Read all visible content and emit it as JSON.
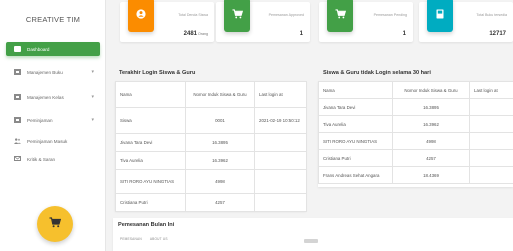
{
  "brand": "CREATIVE TIM",
  "sidebar": {
    "items": [
      {
        "label": "Dashboard",
        "icon": "dashboard-icon",
        "active": true,
        "chevron": ""
      },
      {
        "label": "Manajemen Buku",
        "icon": "book-icon",
        "active": false,
        "chevron": "▾"
      },
      {
        "label": "Manajemen Kelas",
        "icon": "class-icon",
        "active": false,
        "chevron": "▾"
      },
      {
        "label": "Peminjaman",
        "icon": "loan-icon",
        "active": false,
        "chevron": "▾"
      },
      {
        "label": "Peminjaman Masuk",
        "icon": "users-icon",
        "active": false,
        "chevron": ""
      },
      {
        "label": "Kritik & Saran",
        "icon": "message-icon",
        "active": false,
        "chevron": ""
      }
    ]
  },
  "cards": [
    {
      "title": "Total Denda Siswa",
      "value": "2481",
      "unit": "Orang",
      "color": "#fb8c00",
      "icon": "user-icon"
    },
    {
      "title": "Pemesanan Approved",
      "value": "1",
      "unit": "",
      "color": "#43a047",
      "icon": "cart-icon"
    },
    {
      "title": "Pemesanan Pending",
      "value": "1",
      "unit": "",
      "color": "#43a047",
      "icon": "cart-icon"
    },
    {
      "title": "Total Buku tersedia",
      "value": "12717",
      "unit": "",
      "color": "#00acc1",
      "icon": "book-icon"
    }
  ],
  "login_table": {
    "title": "Terakhir Login Siswa & Guru",
    "headers": [
      "Nama",
      "Nomor Induk Siswa & Guru",
      "Last login at"
    ],
    "rows": [
      [
        "Siswa",
        "0001",
        "2021-02-19 10:50:12"
      ],
      [
        "Jivana Tara Devi",
        "16.3895",
        ""
      ],
      [
        "Tiva Aurelia",
        "16.3962",
        ""
      ],
      [
        "SITI RORO AYU NINGTIAS",
        "4998",
        ""
      ],
      [
        "Cristiana Putri",
        "4257",
        ""
      ]
    ]
  },
  "no_login_table": {
    "title": "Siswa & Guru tidak Login selama 30 hari",
    "headers": [
      "Nama",
      "Nomor Induk Siswa & Guru",
      "Last login at"
    ],
    "rows": [
      [
        "Jivana Tara Devi",
        "16.3895",
        ""
      ],
      [
        "Tiva Aurelia",
        "16.3962",
        ""
      ],
      [
        "SITI RORO AYU NINGTIAS",
        "4998",
        ""
      ],
      [
        "Cristiana Putri",
        "4257",
        ""
      ],
      [
        "Frans Andreas Sehat Angara",
        "18.4369",
        ""
      ]
    ]
  },
  "orders": {
    "title": "Pemesanan Bulan Ini",
    "controls": [
      "PEMESANAN",
      "ABOUT US"
    ]
  },
  "fab": {
    "icon": "cart-icon"
  }
}
